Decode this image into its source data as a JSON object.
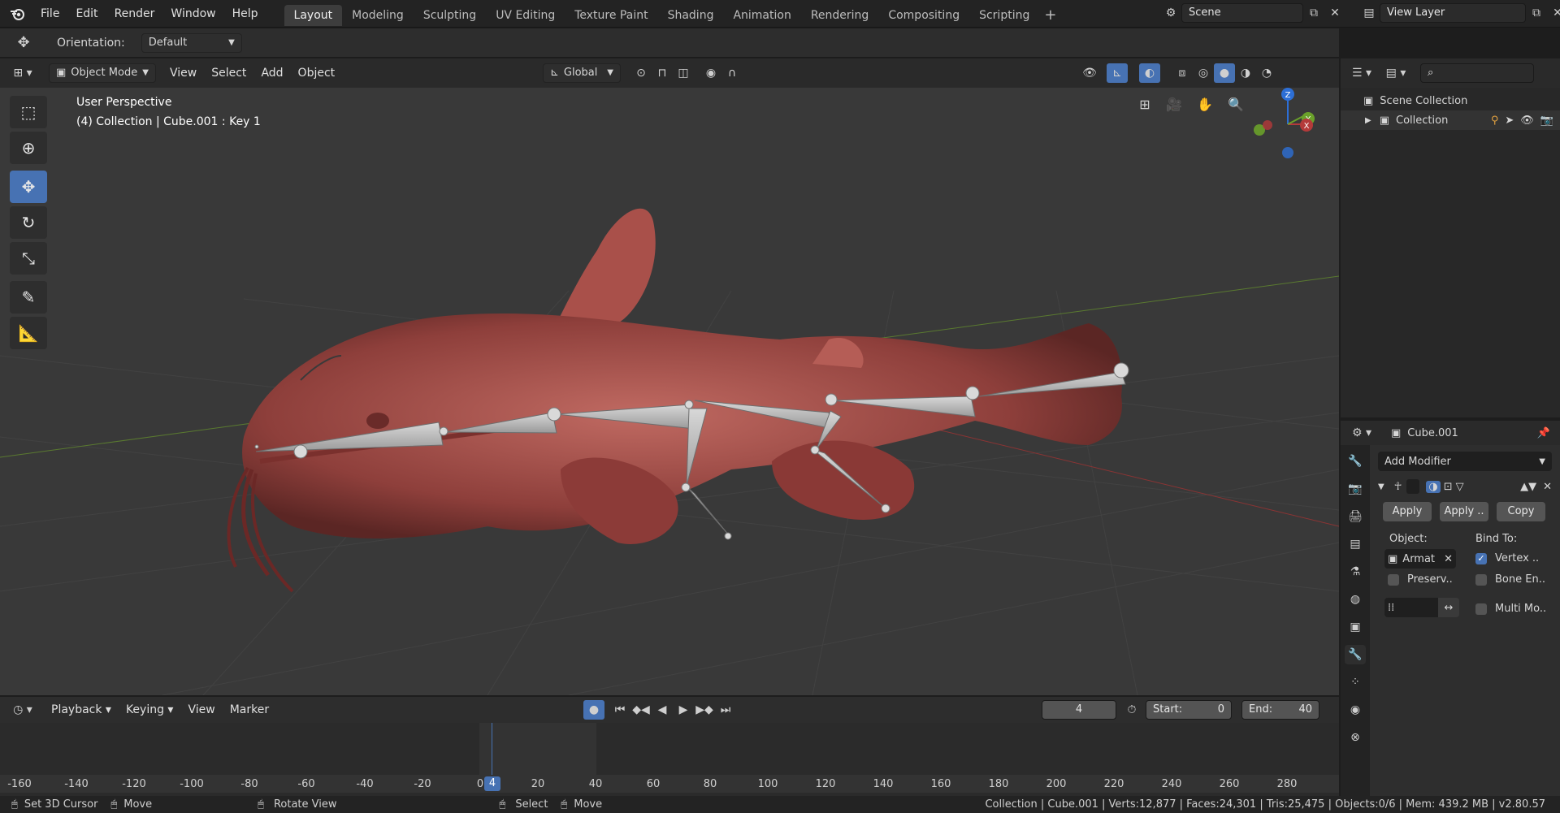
{
  "topbar": {
    "menus": [
      "File",
      "Edit",
      "Render",
      "Window",
      "Help"
    ],
    "workspaces": [
      "Layout",
      "Modeling",
      "Sculpting",
      "UV Editing",
      "Texture Paint",
      "Shading",
      "Animation",
      "Rendering",
      "Compositing",
      "Scripting"
    ],
    "active_workspace": "Layout",
    "scene": "Scene",
    "view_layer": "View Layer"
  },
  "toolsettings": {
    "orientation_label": "Orientation:",
    "orientation_value": "Default"
  },
  "viewheader": {
    "mode": "Object Mode",
    "menus": [
      "View",
      "Select",
      "Add",
      "Object"
    ],
    "transform_orientation": "Global"
  },
  "viewport": {
    "line1": "User Perspective",
    "line2": "(4) Collection | Cube.001 : Key 1",
    "gizmo": {
      "z": "Z",
      "y": "Y",
      "x": "X"
    }
  },
  "outliner": {
    "scene_collection": "Scene Collection",
    "collection": "Collection"
  },
  "properties": {
    "object_name": "Cube.001",
    "add_modifier": "Add Modifier",
    "apply": "Apply",
    "apply_as": "Apply ..",
    "copy": "Copy",
    "object_label": "Object:",
    "bind_to_label": "Bind To:",
    "object_value": "Armat",
    "vertex_groups": "Vertex ..",
    "preserve": "Preserv..",
    "bone_envelopes": "Bone En..",
    "multi_modifier": "Multi Mo..",
    "vertex_groups_checked": true
  },
  "timeline": {
    "menus": [
      "Playback",
      "Keying",
      "View",
      "Marker"
    ],
    "current_frame": "4",
    "start_label": "Start:",
    "start_value": "0",
    "end_label": "End:",
    "end_value": "40",
    "ruler": [
      "-160",
      "-140",
      "-120",
      "-100",
      "-80",
      "-60",
      "-40",
      "-20",
      "0",
      "20",
      "40",
      "60",
      "80",
      "100",
      "120",
      "140",
      "160",
      "180",
      "200",
      "220",
      "240",
      "260",
      "280"
    ],
    "playhead_label": "4"
  },
  "statusbar": {
    "set_cursor": "Set 3D Cursor",
    "move": "Move",
    "rotate_view": "Rotate View",
    "select": "Select",
    "move2": "Move",
    "stats": "Collection | Cube.001 | Verts:12,877 | Faces:24,301 | Tris:25,475 | Objects:0/6 | Mem: 439.2 MB | v2.80.57"
  }
}
